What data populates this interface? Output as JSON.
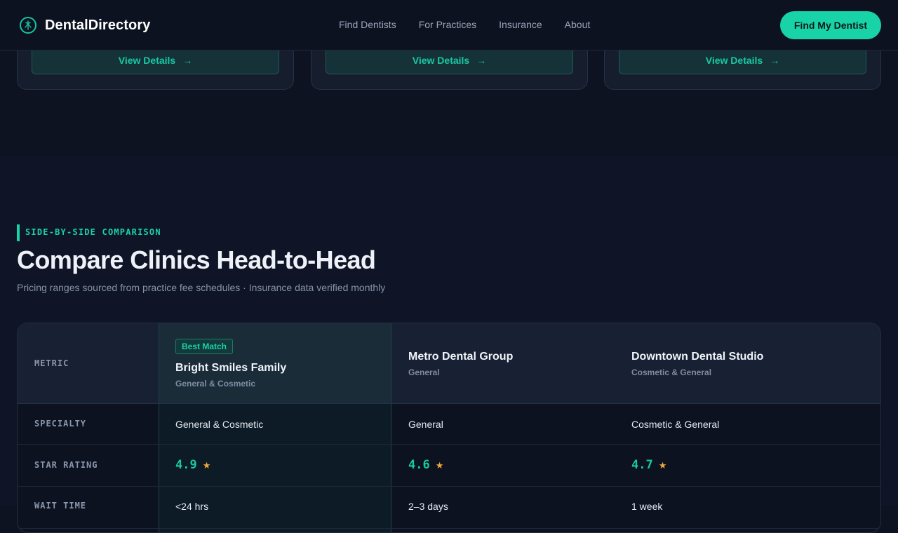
{
  "brand": {
    "name": "DentalDirectory",
    "logo_icon": "tooth-icon"
  },
  "nav": {
    "links": [
      "Find Dentists",
      "For Practices",
      "Insurance",
      "About"
    ],
    "cta": "Find My Dentist"
  },
  "cards": [
    {
      "button": "View Details",
      "arrow": "→"
    },
    {
      "button": "View Details",
      "arrow": "→"
    },
    {
      "button": "View Details",
      "arrow": "→"
    }
  ],
  "section": {
    "eyebrow": "SIDE-BY-SIDE COMPARISON",
    "title": "Compare Clinics Head-to-Head",
    "subtitle": "Pricing ranges sourced from practice fee schedules · Insurance data verified monthly"
  },
  "table": {
    "metric_header": "METRIC",
    "badge": "Best Match",
    "clinics": [
      {
        "name": "Bright Smiles Family",
        "specialty_sub": "General & Cosmetic"
      },
      {
        "name": "Metro Dental Group",
        "specialty_sub": "General"
      },
      {
        "name": "Downtown Dental Studio",
        "specialty_sub": "Cosmetic & General"
      }
    ],
    "rows": [
      {
        "label": "SPECIALTY",
        "values": [
          "General & Cosmetic",
          "General",
          "Cosmetic & General"
        ]
      },
      {
        "label": "STAR RATING",
        "values": [
          "4.9",
          "4.6",
          "4.7"
        ],
        "star": "★"
      },
      {
        "label": "WAIT TIME",
        "values": [
          "<24 hrs",
          "2–3 days",
          "1 week"
        ]
      }
    ]
  },
  "colors": {
    "accent": "#19d3a8",
    "star": "#f2a93b",
    "background": "#0e1321"
  }
}
